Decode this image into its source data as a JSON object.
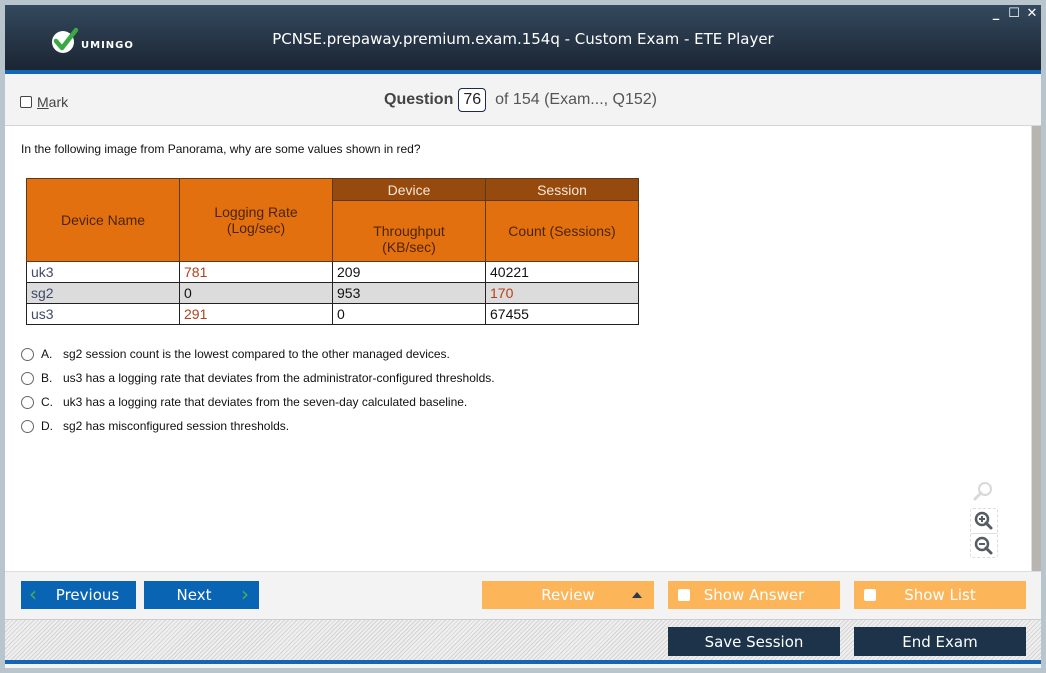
{
  "window": {
    "title": "PCNSE.prepaway.premium.exam.154q - Custom Exam - ETE Player",
    "logo_text": "UMINGO",
    "controls": {
      "minimize": "_",
      "maximize": "☐",
      "close": "✕"
    }
  },
  "question_header": {
    "mark_label": "Mark",
    "mark_accel": "M",
    "mark_rest": "ark",
    "question_label": "Question",
    "current_number": "76",
    "total_text": "of 154 (Exam..., Q152)"
  },
  "question": {
    "text": "In the following image from Panorama, why are some values shown in red?",
    "table": {
      "group_headers": [
        "Device",
        "Session"
      ],
      "headers": [
        "Device Name",
        "Logging Rate (Log/sec)",
        "Throughput (KB/sec)",
        "Count (Sessions)"
      ],
      "header_lines": {
        "logging": [
          "Logging Rate",
          "(Log/sec)"
        ],
        "throughput": [
          "Throughput",
          "(KB/sec)"
        ]
      },
      "rows": [
        {
          "device": "uk3",
          "logging_rate": "781",
          "throughput": "209",
          "sessions": "40221",
          "red": [
            "logging_rate"
          ]
        },
        {
          "device": "sg2",
          "logging_rate": "0",
          "throughput": "953",
          "sessions": "170",
          "red": [
            "sessions"
          ]
        },
        {
          "device": "us3",
          "logging_rate": "291",
          "throughput": "0",
          "sessions": "67455",
          "red": [
            "logging_rate"
          ]
        }
      ]
    },
    "options": [
      {
        "letter": "A.",
        "text": "sg2 session count is the lowest compared to the other managed devices."
      },
      {
        "letter": "B.",
        "text": "us3 has a logging rate that deviates from the administrator-configured thresholds."
      },
      {
        "letter": "C.",
        "text": "uk3 has a logging rate that deviates from the seven-day calculated baseline."
      },
      {
        "letter": "D.",
        "text": "sg2 has misconfigured session thresholds."
      }
    ]
  },
  "zoom_tools": [
    "zoom-reset-icon",
    "zoom-in-icon",
    "zoom-out-icon"
  ],
  "nav": {
    "previous": "Previous",
    "next": "Next",
    "review": "Review",
    "show_answer": "Show Answer",
    "show_list": "Show List",
    "save_session": "Save Session",
    "end_exam": "End Exam"
  },
  "colors": {
    "titlebar": "#1b2533",
    "accent_blue": "#1565b7",
    "nav_blue": "#0a64b4",
    "orange_button": "#fdb55a",
    "navy_button": "#1c3349",
    "table_header": "#e3700f",
    "table_group_header": "#974a0d",
    "red_value": "#b3401a"
  }
}
